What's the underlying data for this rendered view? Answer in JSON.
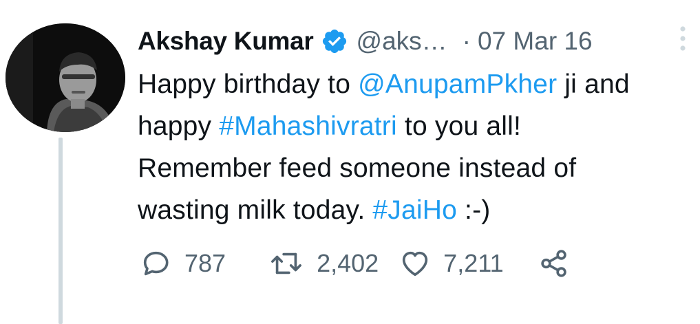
{
  "author": {
    "name": "Akshay Kumar",
    "handle": "@aks…",
    "separator": "·",
    "date": "07 Mar 16",
    "verified_icon": "verified-badge-icon"
  },
  "tweet": {
    "line1": {
      "pre": "Happy birthday to ",
      "mention": "@AnupamPkher",
      "post": " ji and"
    },
    "line2": {
      "pre": "happy ",
      "hashtag": "#Mahashivratri",
      "post": " to you all!"
    },
    "line3": {
      "text": "Remember feed someone instead of"
    },
    "line4": {
      "pre": "wasting milk today. ",
      "hashtag": "#JaiHo",
      "post": " :-)"
    }
  },
  "actions": {
    "reply_count": "787",
    "retweet_count": "2,402",
    "like_count": "7,211",
    "icons": [
      "reply-icon",
      "retweet-icon",
      "like-icon",
      "share-icon"
    ]
  },
  "colors": {
    "link": "#1d9bf0",
    "secondary": "#536471",
    "text": "#0f1419",
    "thread_line": "#cfd9de"
  }
}
